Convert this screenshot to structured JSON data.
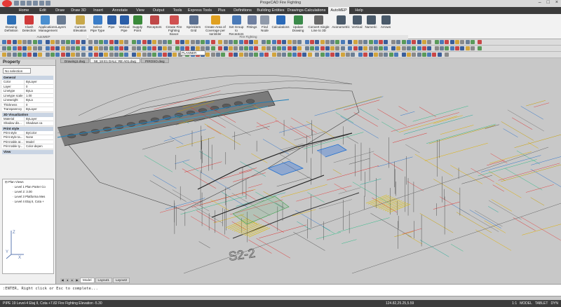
{
  "window": {
    "title": "ProgeCAD Fire Fighting - [58_18 E1 DALL' RE A01.dwg]",
    "title_short": "ProgeCAD Fire Fighting"
  },
  "menu_tabs": [
    "Home",
    "Edit",
    "Draw",
    "Draw 3D",
    "Insert",
    "Annotate",
    "View",
    "Output",
    "Tools",
    "Express Tools",
    "Plus",
    "Definitions",
    "Building Entities",
    "Drawings-Calculations",
    "AutoMEP",
    "Help"
  ],
  "active_tab": "AutoMEP",
  "ribbon": {
    "buttons": [
      {
        "label": "Drawing Definition",
        "color": "#2d6fb5"
      },
      {
        "label": "Clash Detection",
        "color": "#d03a3a"
      },
      {
        "label": "Applications Management",
        "color": "#4a8fd0"
      },
      {
        "label": "Layers",
        "color": "#6a7c93"
      },
      {
        "label": "Current Elevation",
        "color": "#c8a84a"
      },
      {
        "label": "Select Pipe Type",
        "color": "#3a7dc8"
      },
      {
        "label": "Pipe",
        "color": "#2a5ea8"
      },
      {
        "label": "Vertical Pipe",
        "color": "#2a5ea8"
      },
      {
        "label": "Supply Point",
        "color": "#3a8a3a"
      },
      {
        "label": "Receptors",
        "color": "#c04848"
      },
      {
        "label": "Create Fire Fighting Space",
        "color": "#d05050"
      },
      {
        "label": "Sprinklers Grid",
        "color": "#5a6f90"
      },
      {
        "label": "Create Area of Coverage per sprinkler",
        "color": "#e0a020"
      },
      {
        "label": "Set Group to Receptors",
        "color": "#4a7ab8"
      },
      {
        "label": "Fittings",
        "color": "#7080a0"
      },
      {
        "label": "Find Node",
        "color": "#909aaa"
      },
      {
        "label": "Calculations",
        "color": "#2a6ab8"
      },
      {
        "label": "Update Drawing",
        "color": "#3a8a4a"
      },
      {
        "label": "Convert Single Line to 3D",
        "color": "#6a6a6a"
      },
      {
        "label": "Axonometric",
        "color": "#4a5a6a"
      },
      {
        "label": "Vertical",
        "color": "#4a5a6a"
      },
      {
        "label": "Numeric",
        "color": "#4a5a6a"
      },
      {
        "label": "Arrows",
        "color": "#4a5a6a"
      }
    ],
    "groups": [
      "AutoMEP",
      "Fire Fighting"
    ]
  },
  "layer_combo": "PLANNER",
  "left_panel": {
    "title": "Property",
    "selection": "No selection",
    "sections": {
      "general": {
        "title": "General",
        "rows": [
          {
            "k": "Color",
            "v": "ByLayer"
          },
          {
            "k": "Layer",
            "v": "0"
          },
          {
            "k": "Linetype",
            "v": "ByLa"
          },
          {
            "k": "Linetype scale",
            "v": "1.00"
          },
          {
            "k": "Lineweight",
            "v": "ByLa"
          },
          {
            "k": "Thickness",
            "v": "0"
          },
          {
            "k": "Transparency",
            "v": "ByLayer"
          }
        ]
      },
      "visualization": {
        "title": "3D Visualization",
        "rows": [
          {
            "k": "Material",
            "v": "ByLayer"
          },
          {
            "k": "Shadow dis...",
            "v": "Shadows ca"
          }
        ]
      },
      "plot": {
        "title": "Print style",
        "rows": [
          {
            "k": "Print style",
            "v": "ByColor"
          },
          {
            "k": "Print style ta...",
            "v": "None"
          },
          {
            "k": "Print table at...",
            "v": "Model"
          },
          {
            "k": "Print table ty...",
            "v": "Color-depen"
          }
        ]
      },
      "view": {
        "title": "View"
      }
    },
    "tree": {
      "items": [
        "Plan Views",
        "Level 1 Plan Parter Co",
        "Level 2: 3.00",
        "Level 3 Platforma Mes",
        "Level 4 Etaj II, Cota +"
      ]
    }
  },
  "doc_tabs": [
    "Drawing1.dwg",
    "58_18 E1 DALL' RE A01.dwg",
    "PIROSO.dwg"
  ],
  "active_doc": 1,
  "canvas_label": "S2-2",
  "layout_tabs": [
    "Model",
    "Layout1",
    "Layout2"
  ],
  "command_line": ":ENTER, Right click or Esc to complete...",
  "status": {
    "left": "PIPE 19 Level-4 Etaj II, Cota +7.82 Fire Fighting Elevation -5.30",
    "coords": "124.82,25.25,5.59",
    "right": [
      "1:1",
      "MODEL",
      "TABLET",
      "DYN"
    ]
  }
}
